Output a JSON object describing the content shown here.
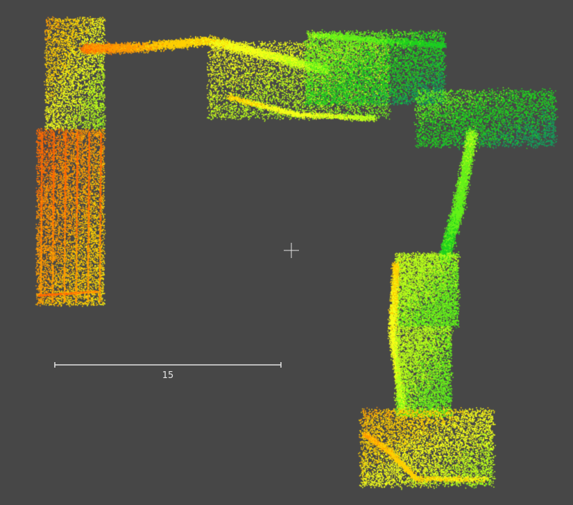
{
  "viewer": {
    "background_color": "#474747",
    "foreground_color": "#e6e6e6",
    "colormap": [
      "#ff6a00",
      "#ff9a00",
      "#ffd000",
      "#f4ff1a",
      "#b8ff1a",
      "#66f21a",
      "#1fd11f",
      "#12a35a",
      "#0e8a6e"
    ]
  },
  "scale_bar": {
    "label": "15"
  },
  "crosshair": {
    "icon": "crosshair-icon"
  }
}
